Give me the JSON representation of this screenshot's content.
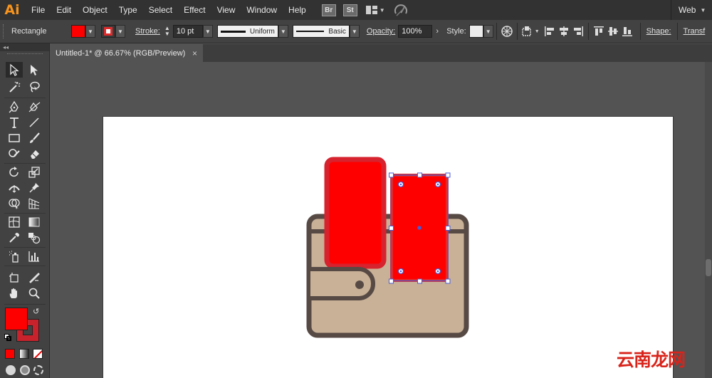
{
  "app": {
    "logo": "Ai"
  },
  "menu": {
    "items": [
      "File",
      "Edit",
      "Object",
      "Type",
      "Select",
      "Effect",
      "View",
      "Window",
      "Help"
    ],
    "bridge_badge": "Br",
    "stock_badge": "St",
    "workspace": "Web"
  },
  "control_bar": {
    "tool_name": "Rectangle",
    "fill_color": "#ff0000",
    "stroke_color": "#e02b2b",
    "stroke_label": "Stroke:",
    "stroke_weight": "10 pt",
    "variable_width_profile": "Uniform",
    "brush_definition": "Basic",
    "opacity_label": "Opacity:",
    "opacity_value": "100%",
    "style_label": "Style:",
    "shape_label": "Shape:",
    "transform_label": "Transf"
  },
  "document": {
    "tab_title": "Untitled-1* @ 66.67% (RGB/Preview)",
    "close_symbol": "×"
  },
  "toolbox": {
    "collapse_symbol": "◂◂",
    "fill_color": "#ff0000",
    "stroke_color": "#c8232c"
  },
  "artwork": {
    "wallet_body_color": "#c9b197",
    "wallet_outline_color": "#574a45",
    "card_back_fill": "#ff0000",
    "card_back_stroke": "#d6232e",
    "card_front_fill": "#ff0000",
    "card_front_stroke": "#e02b2b",
    "selection_color": "#4a5bd4"
  },
  "watermark": {
    "text": "云南龙网",
    "color": "#d8241b"
  }
}
